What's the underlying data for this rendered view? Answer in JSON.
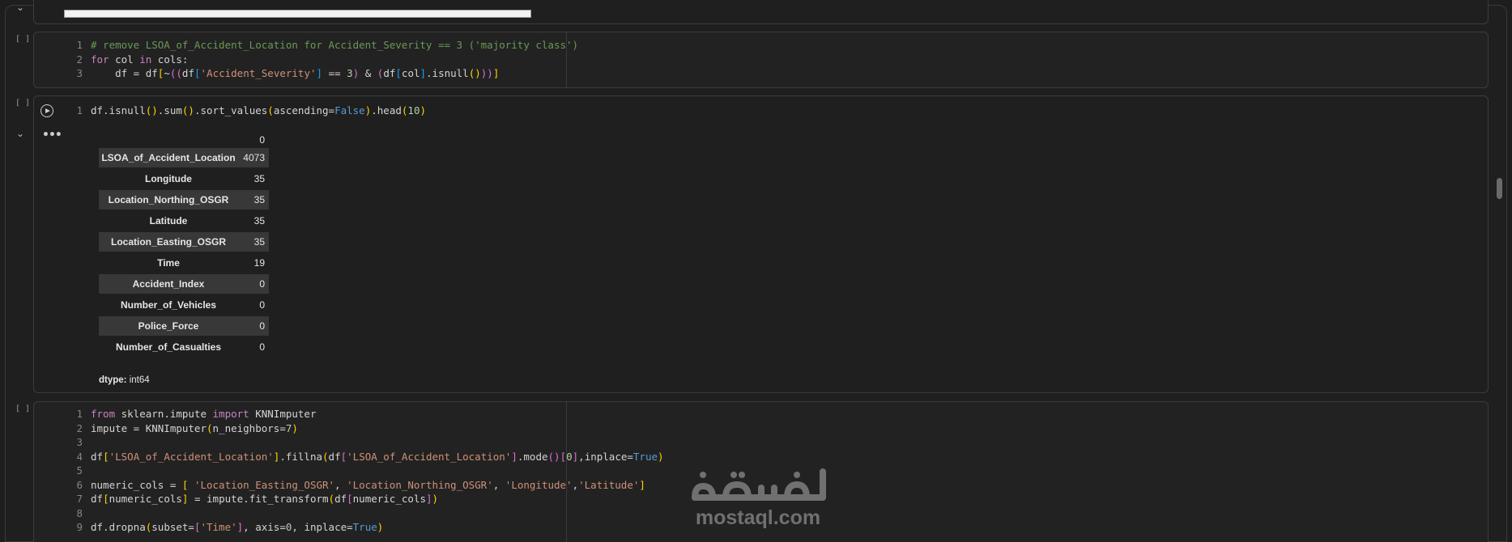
{
  "cells": {
    "top": {
      "collapse_glyph": "⌄"
    },
    "cell1": {
      "bracket": "[ ]",
      "lines": [
        {
          "n": "1",
          "parts": [
            [
              "cmt",
              "# remove LSOA_of_Accident_Location for Accident_Severity == 3 ('majority class')"
            ]
          ]
        },
        {
          "n": "2",
          "parts": [
            [
              "kw2",
              "for"
            ],
            [
              "",
              " col "
            ],
            [
              "kw2",
              "in"
            ],
            [
              "",
              " cols:"
            ]
          ]
        },
        {
          "n": "3",
          "parts": [
            [
              "",
              "    df = df"
            ],
            [
              "br1",
              "["
            ],
            [
              "",
              "~"
            ],
            [
              "br2",
              "(("
            ],
            [
              "",
              "df"
            ],
            [
              "br3",
              "["
            ],
            [
              "str",
              "'Accident_Severity'"
            ],
            [
              "br3",
              "]"
            ],
            [
              "",
              " == "
            ],
            [
              "num",
              "3"
            ],
            [
              "br2",
              ")"
            ],
            [
              "",
              " & "
            ],
            [
              "br2",
              "("
            ],
            [
              "",
              "df"
            ],
            [
              "br3",
              "["
            ],
            [
              "",
              "col"
            ],
            [
              "br3",
              "]"
            ],
            [
              "",
              ".isnull"
            ],
            [
              "br1",
              "()"
            ],
            [
              "br2",
              "))"
            ],
            [
              "br1",
              "]"
            ]
          ]
        }
      ]
    },
    "cell2": {
      "bracket": "[ ]",
      "lines": [
        {
          "n": "1",
          "parts": [
            [
              "",
              "df.isnull"
            ],
            [
              "br1",
              "()"
            ],
            [
              "",
              ".sum"
            ],
            [
              "br1",
              "()"
            ],
            [
              "",
              ".sort_values"
            ],
            [
              "br1",
              "("
            ],
            [
              "",
              "ascending="
            ],
            [
              "bool",
              "False"
            ],
            [
              "br1",
              ")"
            ],
            [
              "",
              ".head"
            ],
            [
              "br1",
              "("
            ],
            [
              "num",
              "10"
            ],
            [
              "br1",
              ")"
            ]
          ]
        }
      ],
      "output": {
        "ellipsis": "•••",
        "collapse_glyph": "⌄",
        "header_value": "0",
        "rows": [
          {
            "label": "LSOA_of_Accident_Location",
            "value": "4073"
          },
          {
            "label": "Longitude",
            "value": "35"
          },
          {
            "label": "Location_Northing_OSGR",
            "value": "35"
          },
          {
            "label": "Latitude",
            "value": "35"
          },
          {
            "label": "Location_Easting_OSGR",
            "value": "35"
          },
          {
            "label": "Time",
            "value": "19"
          },
          {
            "label": "Accident_Index",
            "value": "0"
          },
          {
            "label": "Number_of_Vehicles",
            "value": "0"
          },
          {
            "label": "Police_Force",
            "value": "0"
          },
          {
            "label": "Number_of_Casualties",
            "value": "0"
          }
        ],
        "dtype_label": "dtype:",
        "dtype_value": " int64"
      }
    },
    "cell3": {
      "bracket": "[ ]",
      "lines": [
        {
          "n": "1",
          "parts": [
            [
              "kw2",
              "from"
            ],
            [
              "",
              " sklearn.impute "
            ],
            [
              "kw2",
              "import"
            ],
            [
              "",
              " KNNImputer"
            ]
          ]
        },
        {
          "n": "2",
          "parts": [
            [
              "",
              "impute = KNNImputer"
            ],
            [
              "br1",
              "("
            ],
            [
              "",
              "n_neighbors="
            ],
            [
              "num",
              "7"
            ],
            [
              "br1",
              ")"
            ]
          ]
        },
        {
          "n": "3",
          "parts": []
        },
        {
          "n": "4",
          "parts": [
            [
              "",
              "df"
            ],
            [
              "br1",
              "["
            ],
            [
              "str",
              "'LSOA_of_Accident_Location'"
            ],
            [
              "br1",
              "]"
            ],
            [
              "",
              ".fillna"
            ],
            [
              "br1",
              "("
            ],
            [
              "",
              "df"
            ],
            [
              "br2",
              "["
            ],
            [
              "str",
              "'LSOA_of_Accident_Location'"
            ],
            [
              "br2",
              "]"
            ],
            [
              "",
              ".mode"
            ],
            [
              "br2",
              "()"
            ],
            [
              "br2",
              "["
            ],
            [
              "num",
              "0"
            ],
            [
              "br2",
              "]"
            ],
            [
              "",
              ",inplace="
            ],
            [
              "bool",
              "True"
            ],
            [
              "br1",
              ")"
            ]
          ]
        },
        {
          "n": "5",
          "parts": []
        },
        {
          "n": "6",
          "parts": [
            [
              "",
              "numeric_cols = "
            ],
            [
              "br1",
              "["
            ],
            [
              "",
              " "
            ],
            [
              "str",
              "'Location_Easting_OSGR'"
            ],
            [
              "",
              ", "
            ],
            [
              "str",
              "'Location_Northing_OSGR'"
            ],
            [
              "",
              ", "
            ],
            [
              "str",
              "'Longitude'"
            ],
            [
              "",
              ","
            ],
            [
              "str",
              "'Latitude'"
            ],
            [
              "br1",
              "]"
            ]
          ]
        },
        {
          "n": "7",
          "parts": [
            [
              "",
              "df"
            ],
            [
              "br1",
              "["
            ],
            [
              "",
              "numeric_cols"
            ],
            [
              "br1",
              "]"
            ],
            [
              "",
              " = impute.fit_transform"
            ],
            [
              "br1",
              "("
            ],
            [
              "",
              "df"
            ],
            [
              "br2",
              "["
            ],
            [
              "",
              "numeric_cols"
            ],
            [
              "br2",
              "]"
            ],
            [
              "br1",
              ")"
            ]
          ]
        },
        {
          "n": "8",
          "parts": []
        },
        {
          "n": "9",
          "parts": [
            [
              "",
              "df.dropna"
            ],
            [
              "br1",
              "("
            ],
            [
              "",
              "subset="
            ],
            [
              "br2",
              "["
            ],
            [
              "str",
              "'Time'"
            ],
            [
              "br2",
              "]"
            ],
            [
              "",
              ", axis="
            ],
            [
              "num",
              "0"
            ],
            [
              "",
              ", inplace="
            ],
            [
              "bool",
              "True"
            ],
            [
              "br1",
              ")"
            ]
          ]
        }
      ]
    }
  },
  "watermark": {
    "arabic": "مستقل",
    "latin": "mostaql.com"
  }
}
